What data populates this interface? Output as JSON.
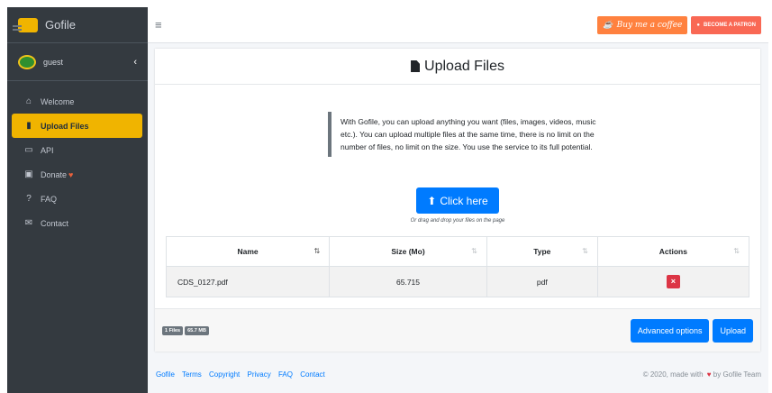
{
  "brand": {
    "name": "Gofile"
  },
  "user": {
    "name": "guest"
  },
  "sidebar": {
    "items": [
      {
        "label": "Welcome",
        "icon": "home-icon"
      },
      {
        "label": "Upload Files",
        "icon": "file-upload-icon",
        "active": true
      },
      {
        "label": "API",
        "icon": "api-icon"
      },
      {
        "label": "Donate",
        "icon": "gift-icon"
      },
      {
        "label": "FAQ",
        "icon": "question-icon"
      },
      {
        "label": "Contact",
        "icon": "envelope-icon"
      }
    ]
  },
  "topbar": {
    "coffee_label": "Buy me a coffee",
    "patron_label": "BECOME A PATRON"
  },
  "card": {
    "title": "Upload Files",
    "intro": "With Gofile, you can upload anything you want (files, images, videos, music etc.). You can upload multiple files at the same time, there is no limit on the number of files, no limit on the size. You use the service to its full potential.",
    "click_label": "Click here",
    "drag_hint": "Or drag and drop your files on the page"
  },
  "table": {
    "columns": [
      "Name",
      "Size (Mo)",
      "Type",
      "Actions"
    ],
    "rows": [
      {
        "name": "CDS_0127.pdf",
        "size": "65.715",
        "type": "pdf",
        "action": "×"
      }
    ]
  },
  "footer": {
    "files_badge": "1 Files",
    "size_badge": "65.7 MB",
    "advanced_label": "Advanced options",
    "upload_label": "Upload"
  },
  "page_footer": {
    "links": [
      "Gofile",
      "Terms",
      "Copyright",
      "Privacy",
      "FAQ",
      "Contact"
    ],
    "copyright_prefix": "© 2020, made with",
    "copyright_suffix": "by Gofile Team"
  },
  "colors": {
    "sidebar_bg": "#343a40",
    "active_item": "#f0b400",
    "primary": "#007bff",
    "danger": "#dc3545",
    "coffee": "#ff813f",
    "patron": "#f96854"
  }
}
